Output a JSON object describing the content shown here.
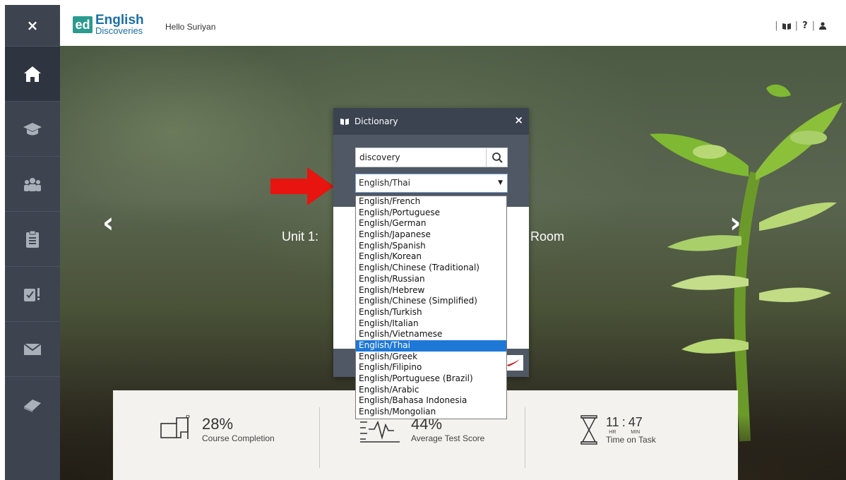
{
  "sidebar": {
    "close_label": "×",
    "items": [
      {
        "name": "home",
        "icon": "home-icon",
        "active": true
      },
      {
        "name": "courses",
        "icon": "graduation-cap-icon"
      },
      {
        "name": "community",
        "icon": "group-icon"
      },
      {
        "name": "tasks",
        "icon": "clipboard-icon"
      },
      {
        "name": "assessment",
        "icon": "assessment-icon"
      },
      {
        "name": "messages",
        "icon": "envelope-icon"
      },
      {
        "name": "library",
        "icon": "book-icon"
      }
    ]
  },
  "header": {
    "logo_badge": "ed",
    "logo_title": "English",
    "logo_subtitle": "Discoveries",
    "greeting": "Hello Suriyan",
    "sep": "|",
    "help_label": "?"
  },
  "carousel": {
    "prev": "‹",
    "next": "›",
    "title_start": "Unit 1:",
    "title_end": "Room"
  },
  "stats": {
    "completion_value": "28%",
    "completion_label": "Course Completion",
    "score_value": "44%",
    "score_label": "Average Test Score",
    "time_hours": "11",
    "time_sep": ":",
    "time_minutes": "47",
    "hr_label": "HR",
    "min_label": "MIN",
    "time_label": "Time on Task"
  },
  "dictionary": {
    "title": "Dictionary",
    "close": "×",
    "search_value": "discovery",
    "selected_language": "English/Thai",
    "caret": "▼",
    "options": [
      "English/French",
      "English/Portuguese",
      "English/German",
      "English/Japanese",
      "English/Spanish",
      "English/Korean",
      "English/Chinese (Traditional)",
      "English/Russian",
      "English/Hebrew",
      "English/Chinese (Simplified)",
      "English/Turkish",
      "English/Italian",
      "English/Vietnamese",
      "English/Thai",
      "English/Greek",
      "English/Filipino",
      "English/Portuguese (Brazil)",
      "English/Arabic",
      "English/Bahasa Indonesia",
      "English/Mongolian"
    ],
    "selected_index": 13
  },
  "colors": {
    "sidebar": "#3d4450",
    "brand_teal": "#2b9b8f",
    "brand_blue": "#1a6fa8",
    "selection": "#1e78d7",
    "arrow": "#e8140f"
  }
}
